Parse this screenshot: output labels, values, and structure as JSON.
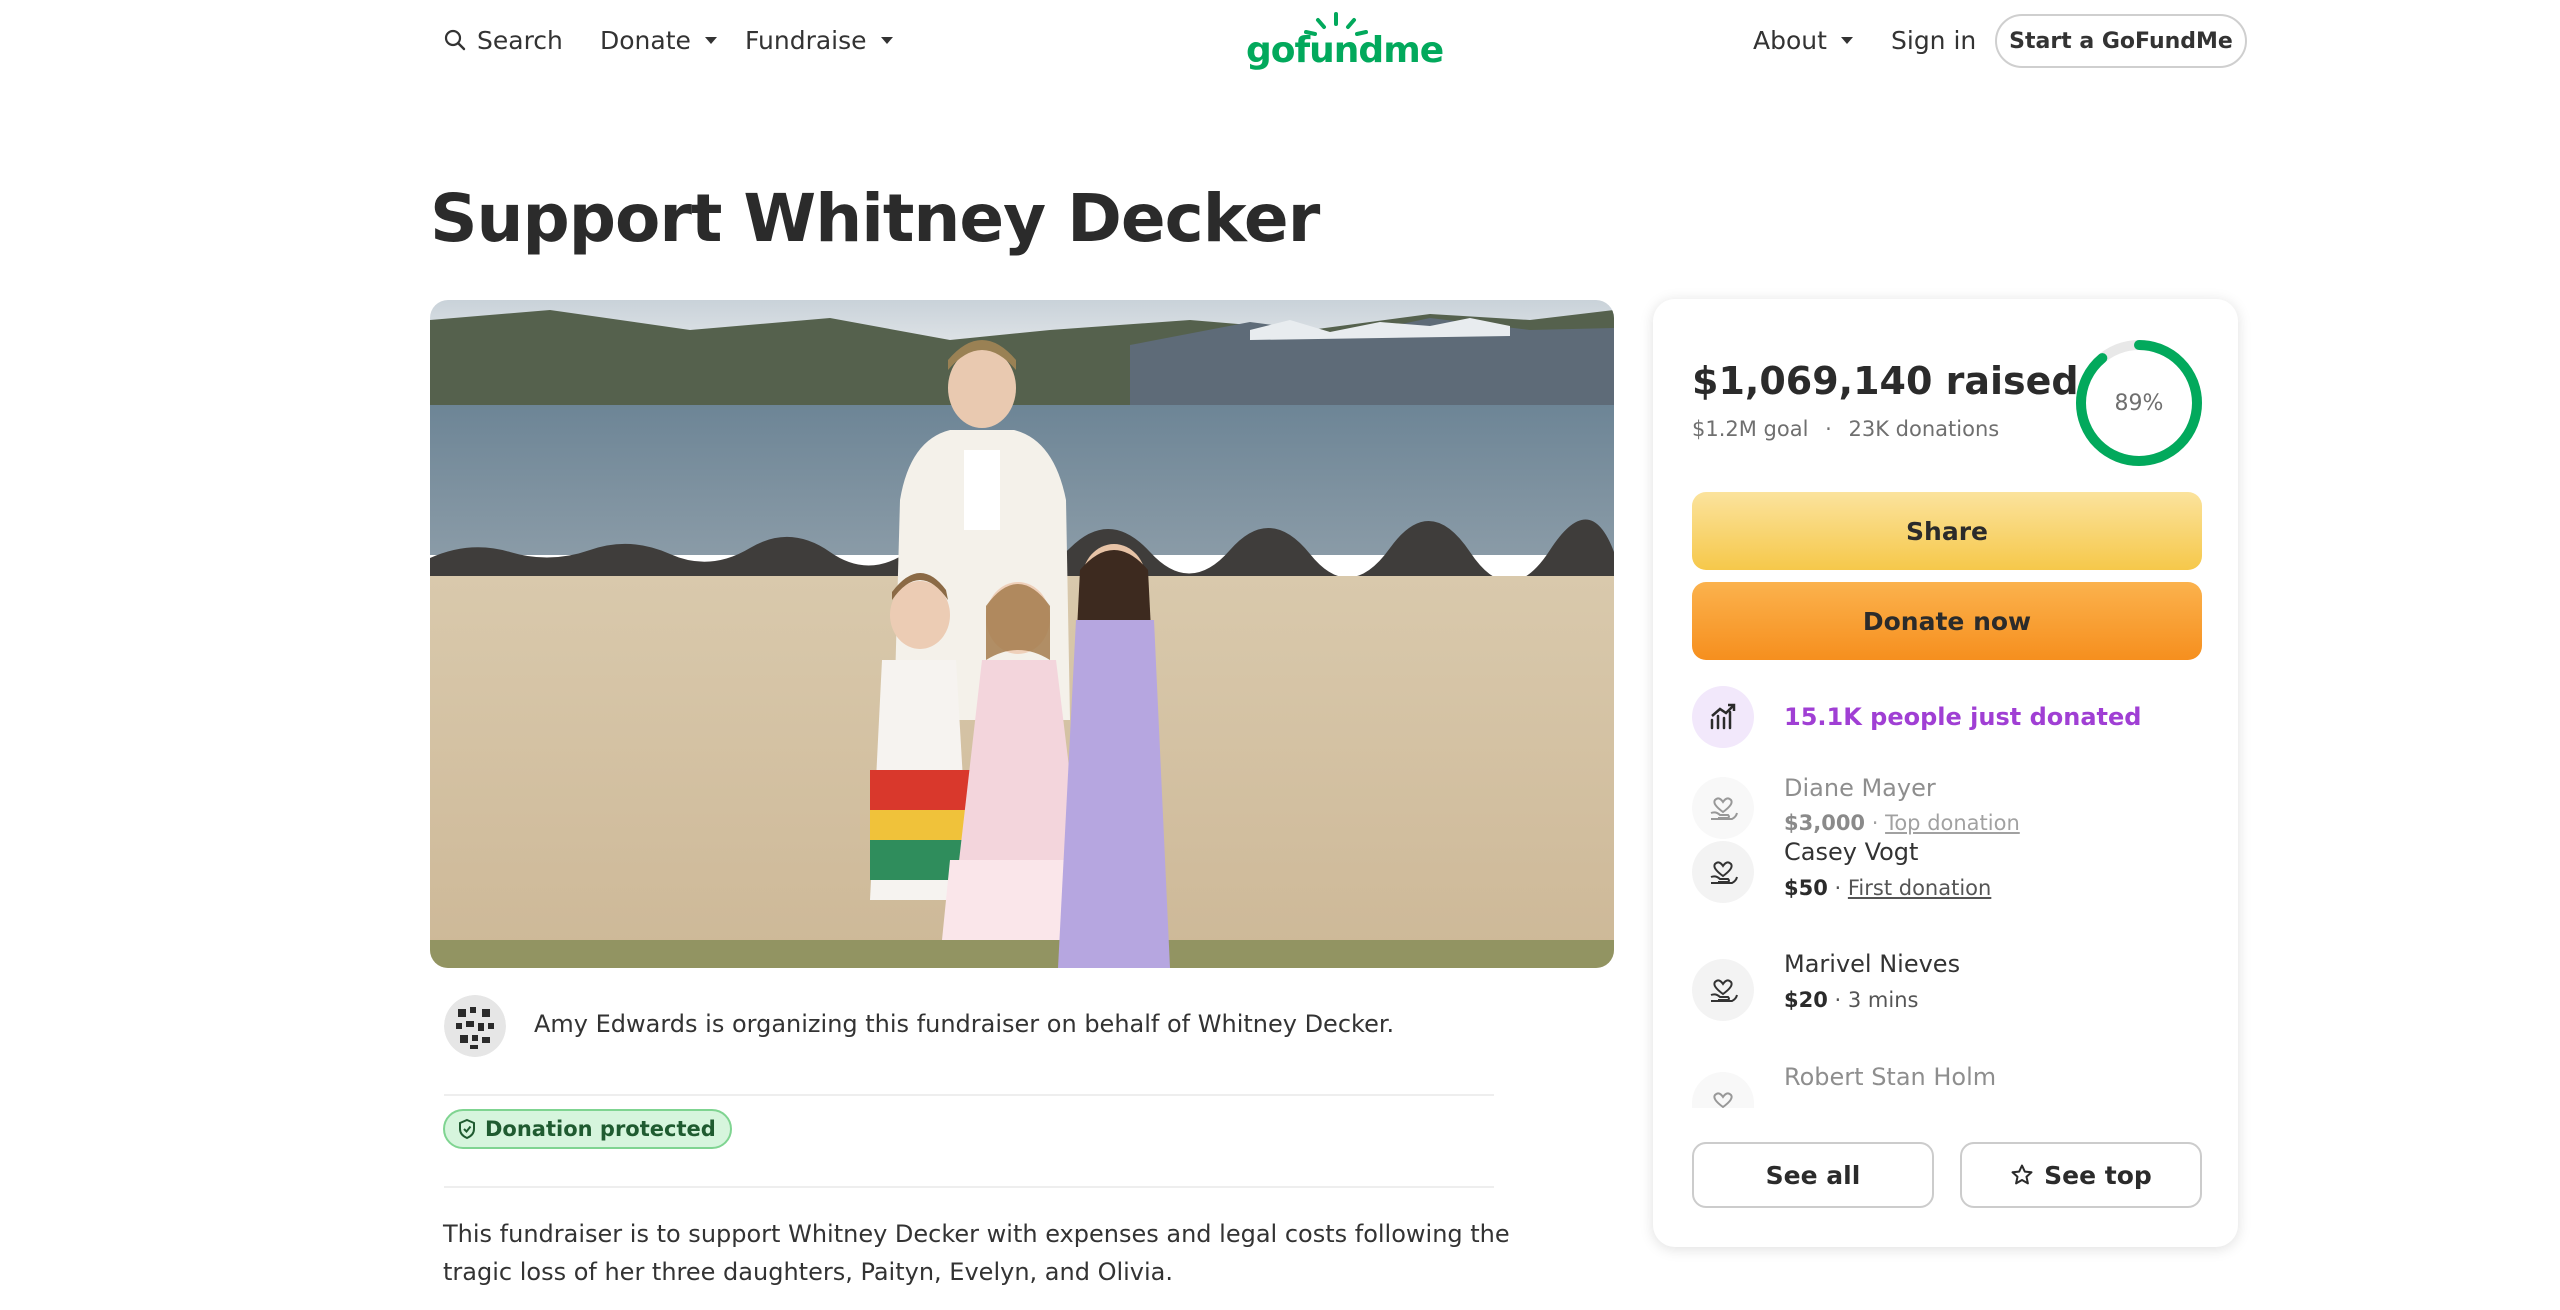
{
  "header": {
    "search_label": "Search",
    "donate_label": "Donate",
    "fundraise_label": "Fundraise",
    "logo_text": "gofundme",
    "about_label": "About",
    "signin_label": "Sign in",
    "start_label": "Start a GoFundMe"
  },
  "campaign": {
    "title": "Support Whitney Decker",
    "organizer_text": "Amy Edwards is organizing this fundraiser on behalf of Whitney Decker.",
    "protected_label": "Donation protected",
    "story": "This fundraiser is to support Whitney Decker with expenses and legal costs following the tragic loss of her three daughters, Paityn, Evelyn, and Olivia."
  },
  "card": {
    "raised": "$1,069,140 raised",
    "goal": "$1.2M goal",
    "separator": "·",
    "donations": "23K donations",
    "progress_label": "89%",
    "progress_fraction": 0.89,
    "share_label": "Share",
    "donate_label": "Donate now",
    "trend_text": "15.1K people just donated",
    "donors": [
      {
        "name": "Diane Mayer",
        "amount": "$3,000",
        "sep": " · ",
        "note": "Top donation"
      },
      {
        "name": "Casey Vogt",
        "amount": "$50",
        "sep": " · ",
        "note": "First donation"
      },
      {
        "name": "Marivel Nieves",
        "amount": "$20",
        "sep": " · ",
        "note": "3 mins"
      },
      {
        "name": "Robert Stan Holm"
      }
    ],
    "see_all_label": "See all",
    "see_top_label": "See top"
  },
  "colors": {
    "brand_green": "#02a95c",
    "share_yellow": "#f6c84a",
    "donate_orange": "#f68f1e",
    "trend_purple": "#a03fd4",
    "badge_green_bg": "#d6f5dd"
  }
}
